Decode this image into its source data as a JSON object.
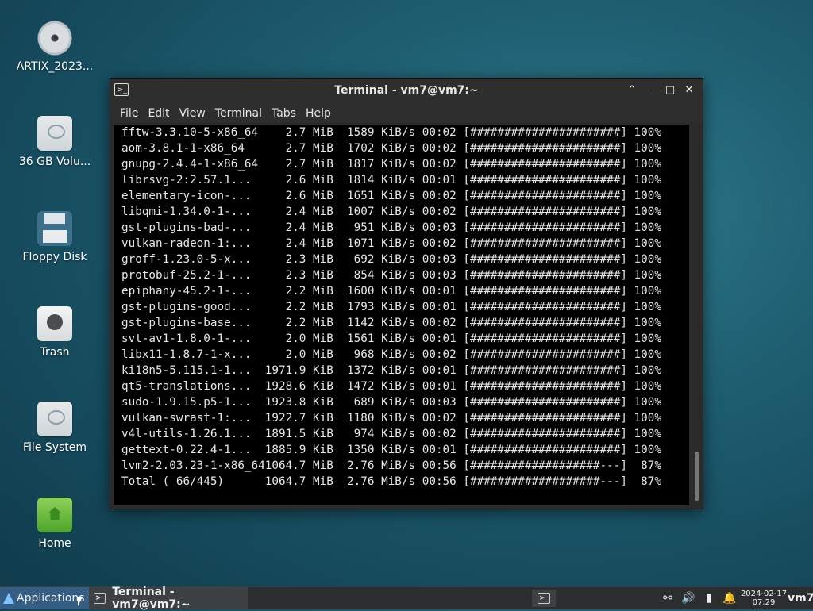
{
  "desktop": {
    "icons": [
      {
        "label": "ARTIX_2023..."
      },
      {
        "label": "36 GB Volu..."
      },
      {
        "label": "Floppy Disk"
      },
      {
        "label": "Trash"
      },
      {
        "label": "File System"
      },
      {
        "label": "Home"
      }
    ]
  },
  "window": {
    "title": "Terminal - vm7@vm7:~",
    "prompt_glyph": ">_",
    "controls": {
      "up": "⌃",
      "minimize": "–",
      "maximize": "□",
      "close": "✕"
    },
    "menu": [
      "File",
      "Edit",
      "View",
      "Terminal",
      "Tabs",
      "Help"
    ]
  },
  "terminal": {
    "lines": [
      "fftw-3.3.10-5-x86_64    2.7 MiB  1589 KiB/s 00:02 [######################] 100%",
      "aom-3.8.1-1-x86_64      2.7 MiB  1702 KiB/s 00:02 [######################] 100%",
      "gnupg-2.4.4-1-x86_64    2.7 MiB  1817 KiB/s 00:02 [######################] 100%",
      "librsvg-2:2.57.1...     2.6 MiB  1814 KiB/s 00:01 [######################] 100%",
      "elementary-icon-...     2.6 MiB  1651 KiB/s 00:02 [######################] 100%",
      "libqmi-1.34.0-1-...     2.4 MiB  1007 KiB/s 00:02 [######################] 100%",
      "gst-plugins-bad-...     2.4 MiB   951 KiB/s 00:03 [######################] 100%",
      "vulkan-radeon-1:...     2.4 MiB  1071 KiB/s 00:02 [######################] 100%",
      "groff-1.23.0-5-x...     2.3 MiB   692 KiB/s 00:03 [######################] 100%",
      "protobuf-25.2-1-...     2.3 MiB   854 KiB/s 00:03 [######################] 100%",
      "epiphany-45.2-1-...     2.2 MiB  1600 KiB/s 00:01 [######################] 100%",
      "gst-plugins-good...     2.2 MiB  1793 KiB/s 00:01 [######################] 100%",
      "gst-plugins-base...     2.2 MiB  1142 KiB/s 00:02 [######################] 100%",
      "svt-av1-1.8.0-1-...     2.0 MiB  1561 KiB/s 00:01 [######################] 100%",
      "libx11-1.8.7-1-x...     2.0 MiB   968 KiB/s 00:02 [######################] 100%",
      "ki18n5-5.115.1-1...  1971.9 KiB  1372 KiB/s 00:01 [######################] 100%",
      "qt5-translations...  1928.6 KiB  1472 KiB/s 00:01 [######################] 100%",
      "sudo-1.9.15.p5-1...  1923.8 KiB   689 KiB/s 00:03 [######################] 100%",
      "vulkan-swrast-1:...  1922.7 KiB  1180 KiB/s 00:02 [######################] 100%",
      "v4l-utils-1.26.1...  1891.5 KiB   974 KiB/s 00:02 [######################] 100%",
      "gettext-0.22.4-1...  1885.9 KiB  1350 KiB/s 00:01 [######################] 100%",
      "lvm2-2.03.23-1-x86_641064.7 MiB  2.76 MiB/s 00:56 [###################---]  87%",
      "Total ( 66/445)      1064.7 MiB  2.76 MiB/s 00:56 [###################---]  87%"
    ]
  },
  "taskbar": {
    "applications_label": "Applications",
    "task_title": "Terminal - vm7@vm7:~",
    "date": "2024-02-17",
    "time": "07:29",
    "user": "vm7",
    "tray_icons": [
      "network-icon",
      "volume-icon",
      "battery-icon",
      "notification-icon"
    ]
  },
  "colors": {
    "terminal_bg": "#000000",
    "terminal_fg": "#e6e6e6",
    "titlebar_bg": "#2e2e2e",
    "taskbar_bg": "#2b2d2f",
    "applications_bg": "#355e85"
  }
}
